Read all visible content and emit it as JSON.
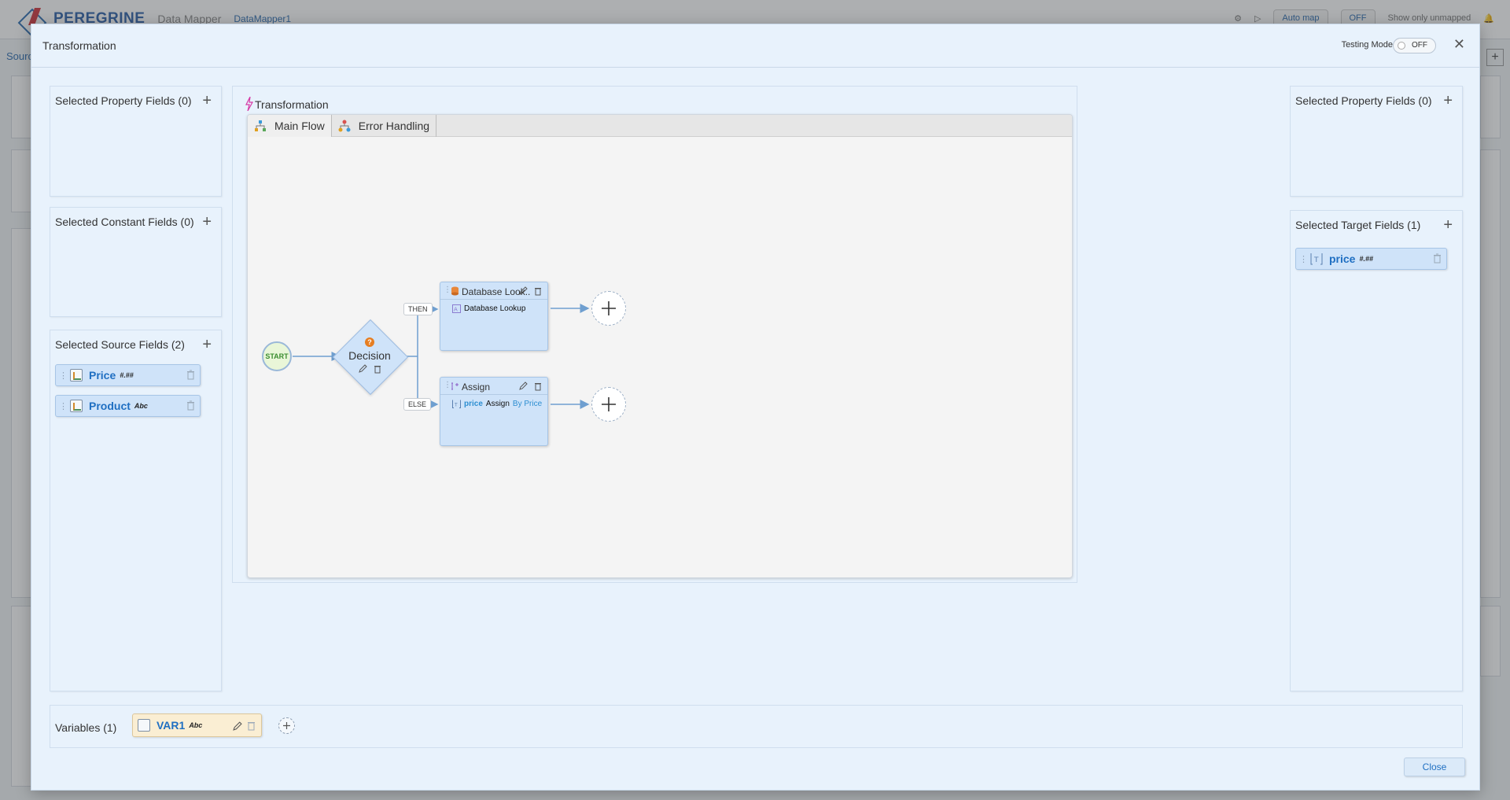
{
  "background": {
    "brand": "PEREGRINE",
    "subtitle": "Data Mapper",
    "mapper_name": "DataMapper1",
    "auto_map": "Auto map",
    "toggle": "OFF",
    "show_unmapped": "Show only unmapped",
    "source_label": "Sourc"
  },
  "modal": {
    "title": "Transformation",
    "testing_mode_label": "Testing Mode",
    "testing_mode_value": "OFF",
    "close_button": "Close"
  },
  "left_panels": {
    "property": {
      "title": "Selected Property Fields (0)"
    },
    "constant": {
      "title": "Selected Constant Fields (0)"
    },
    "source": {
      "title": "Selected Source Fields (2)",
      "fields": [
        {
          "name": "Price",
          "type": "#.##"
        },
        {
          "name": "Product",
          "type": "Abc"
        }
      ]
    }
  },
  "right_panels": {
    "property": {
      "title": "Selected Property Fields (0)"
    },
    "target": {
      "title": "Selected Target Fields (1)",
      "fields": [
        {
          "name": "price",
          "type": "#.##"
        }
      ]
    }
  },
  "center": {
    "title": "Transformation",
    "tabs": [
      {
        "label": "Main Flow",
        "icon": "flow-icon"
      },
      {
        "label": "Error Handling",
        "icon": "error-flow-icon"
      }
    ],
    "flow": {
      "start_label": "START",
      "decision_label": "Decision",
      "then_label": "THEN",
      "else_label": "ELSE",
      "lookup_card": {
        "title": "Database Look...",
        "body": "Database Lookup"
      },
      "assign_card": {
        "title": "Assign",
        "field": "price",
        "op": "Assign",
        "source": "By Price"
      }
    }
  },
  "variables": {
    "title": "Variables (1)",
    "items": [
      {
        "name": "VAR1",
        "type": "Abc"
      }
    ]
  },
  "colors": {
    "modal_bg": "#e8f2fc",
    "chip_bg": "#cfe3f9",
    "var_chip_bg": "#faeed3",
    "link_blue": "#1f6fc2",
    "start_green": "#3a8d2f",
    "decision_orange": "#e67e22"
  }
}
